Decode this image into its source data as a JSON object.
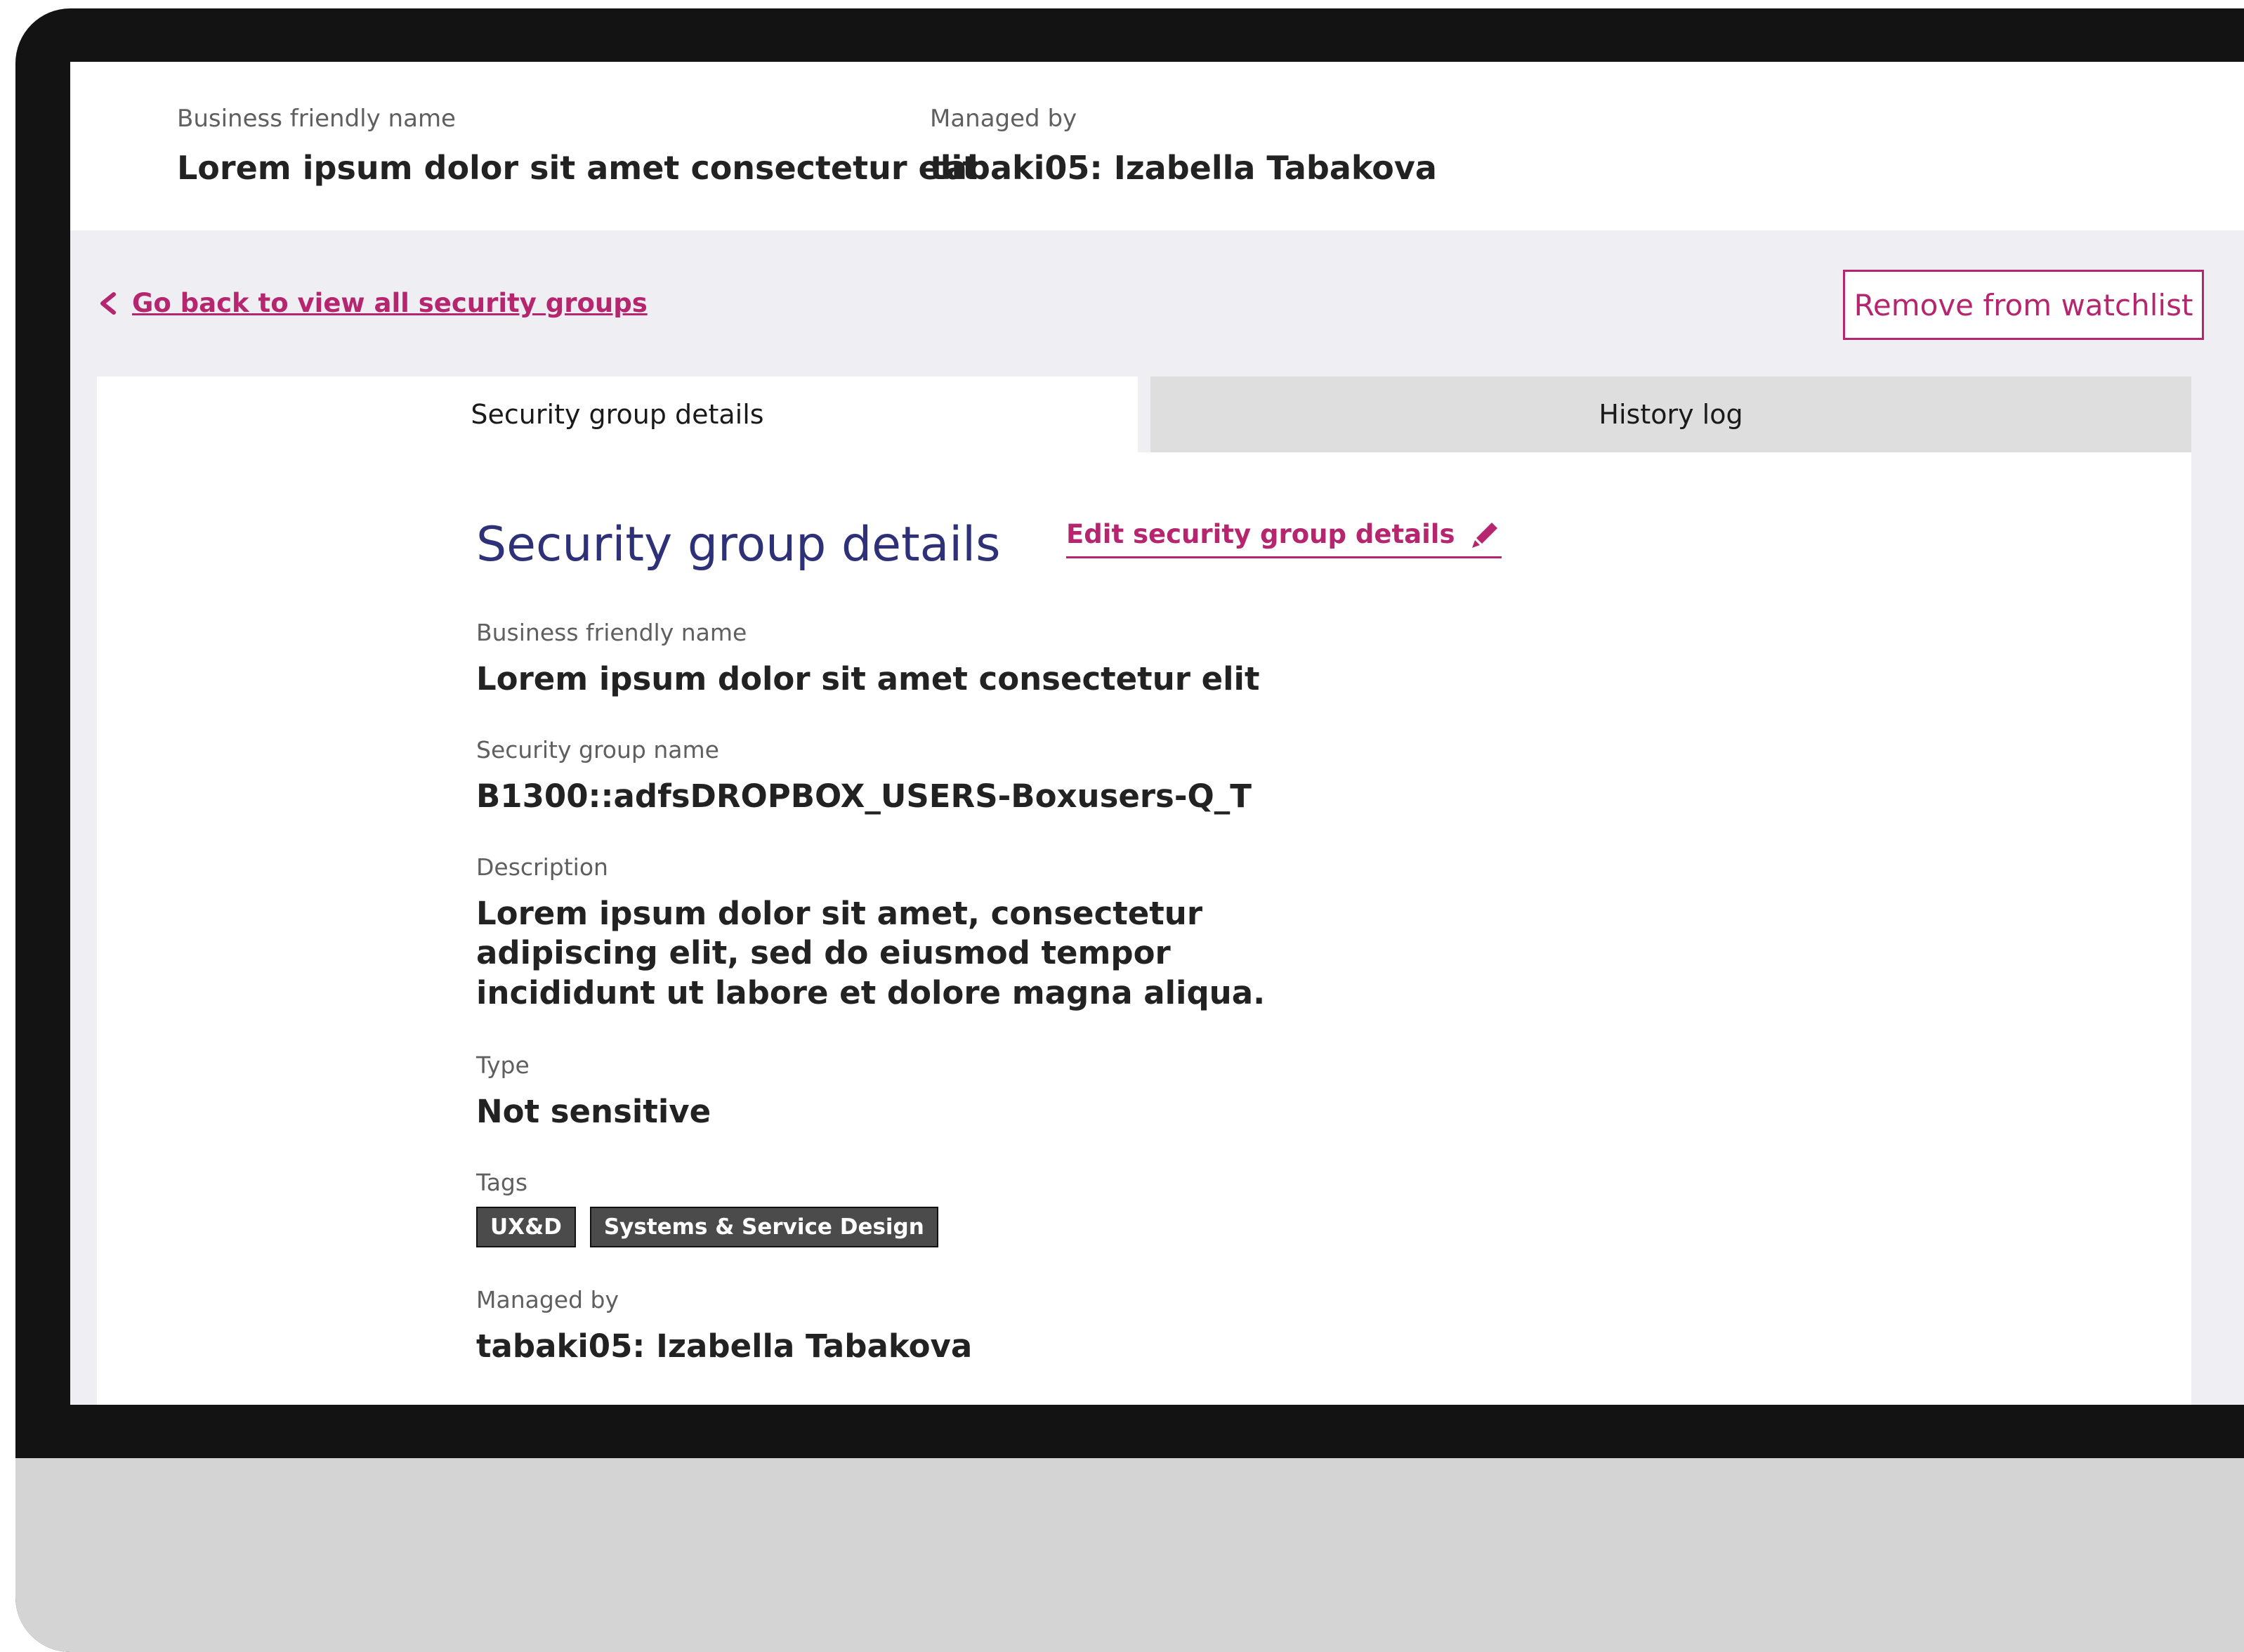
{
  "header": {
    "business_name_label": "Business friendly name",
    "business_name_value": "Lorem ipsum dolor sit amet consectetur elit",
    "managed_by_label": "Managed by",
    "managed_by_value": "tabaki05: Izabella Tabakova"
  },
  "nav": {
    "back_link": "Go back to view all security groups",
    "watchlist_button": "Remove from watchlist"
  },
  "tabs": [
    {
      "label": "Security group details",
      "active": true
    },
    {
      "label": "History log",
      "active": false
    }
  ],
  "details": {
    "title": "Security group details",
    "edit_link": "Edit security group details",
    "fields": {
      "business_name": {
        "label": "Business friendly name",
        "value": "Lorem ipsum dolor sit amet consectetur elit"
      },
      "group_name": {
        "label": "Security group name",
        "value": "B1300::adfsDROPBOX_USERS-Boxusers-Q_T"
      },
      "description": {
        "label": "Description",
        "value": "Lorem ipsum dolor sit amet, consectetur adipiscing elit, sed do eiusmod tempor incididunt ut labore et dolore magna aliqua."
      },
      "type": {
        "label": "Type",
        "value": "Not sensitive"
      },
      "tags": {
        "label": "Tags",
        "items": [
          "UX&D",
          "Systems & Service Design"
        ]
      },
      "managed_by": {
        "label": "Managed by",
        "value": "tabaki05: Izabella Tabakova"
      }
    }
  },
  "icons": {
    "back": "chevron-left-icon",
    "edit": "pencil-icon"
  },
  "colors": {
    "accent": "#b5266f",
    "title": "#2e3178",
    "tag_bg": "#4b4b4b",
    "page_bg": "#efeef3",
    "inactive_tab": "#dedede"
  }
}
